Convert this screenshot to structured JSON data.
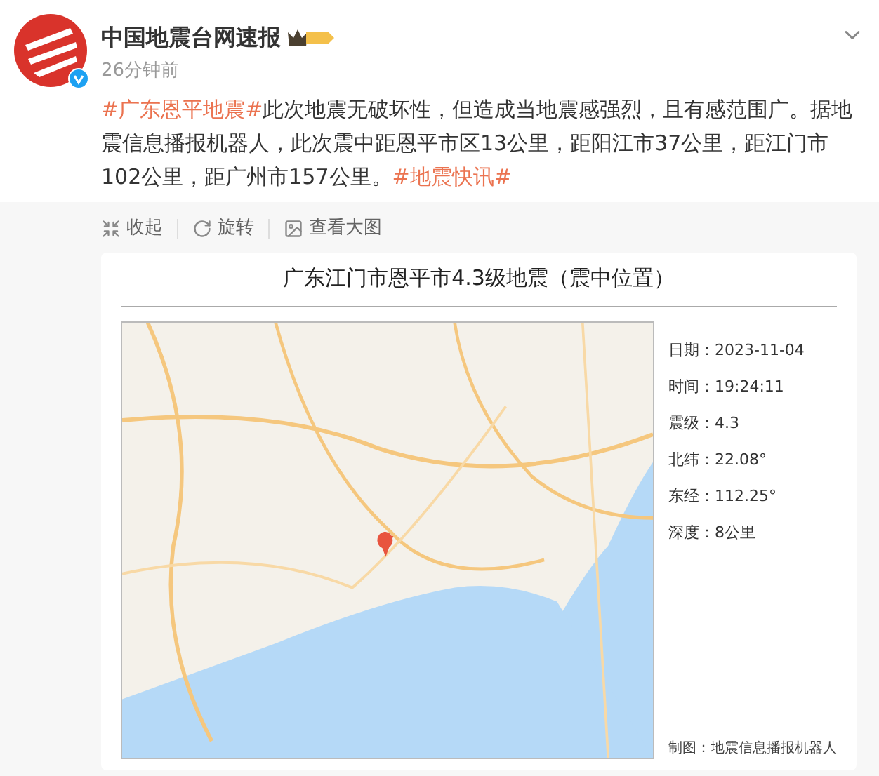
{
  "post": {
    "author": "中国地震台网速报",
    "time": "26分钟前",
    "verified": true,
    "text": [
      {
        "kind": "topic",
        "text": "#广东恩平地震#"
      },
      {
        "kind": "plain",
        "text": "此次地震无破坏性，但造成当地震感强烈，且有感范围广。据地震信息播报机器人，此次震中距恩平市区13公里，距阳江市37公里，距江门市102公里，距广州市157公里。"
      },
      {
        "kind": "topic",
        "text": "#地震快讯#"
      }
    ]
  },
  "actions": [
    {
      "label": "收起",
      "kind": "collapse"
    },
    {
      "label": "旋转",
      "kind": "rotate"
    },
    {
      "label": "查看大图",
      "kind": "view"
    }
  ],
  "image": {
    "title": "广东江门市恩平市4.3级地震（震中位置）",
    "details": [
      "日期：2023-11-04",
      "时间：19:24:11",
      "震级：4.3",
      "北纬：22.08°",
      "东经：112.25°",
      "深度：8公里"
    ],
    "credit": "制图：地震信息播报机器人"
  }
}
